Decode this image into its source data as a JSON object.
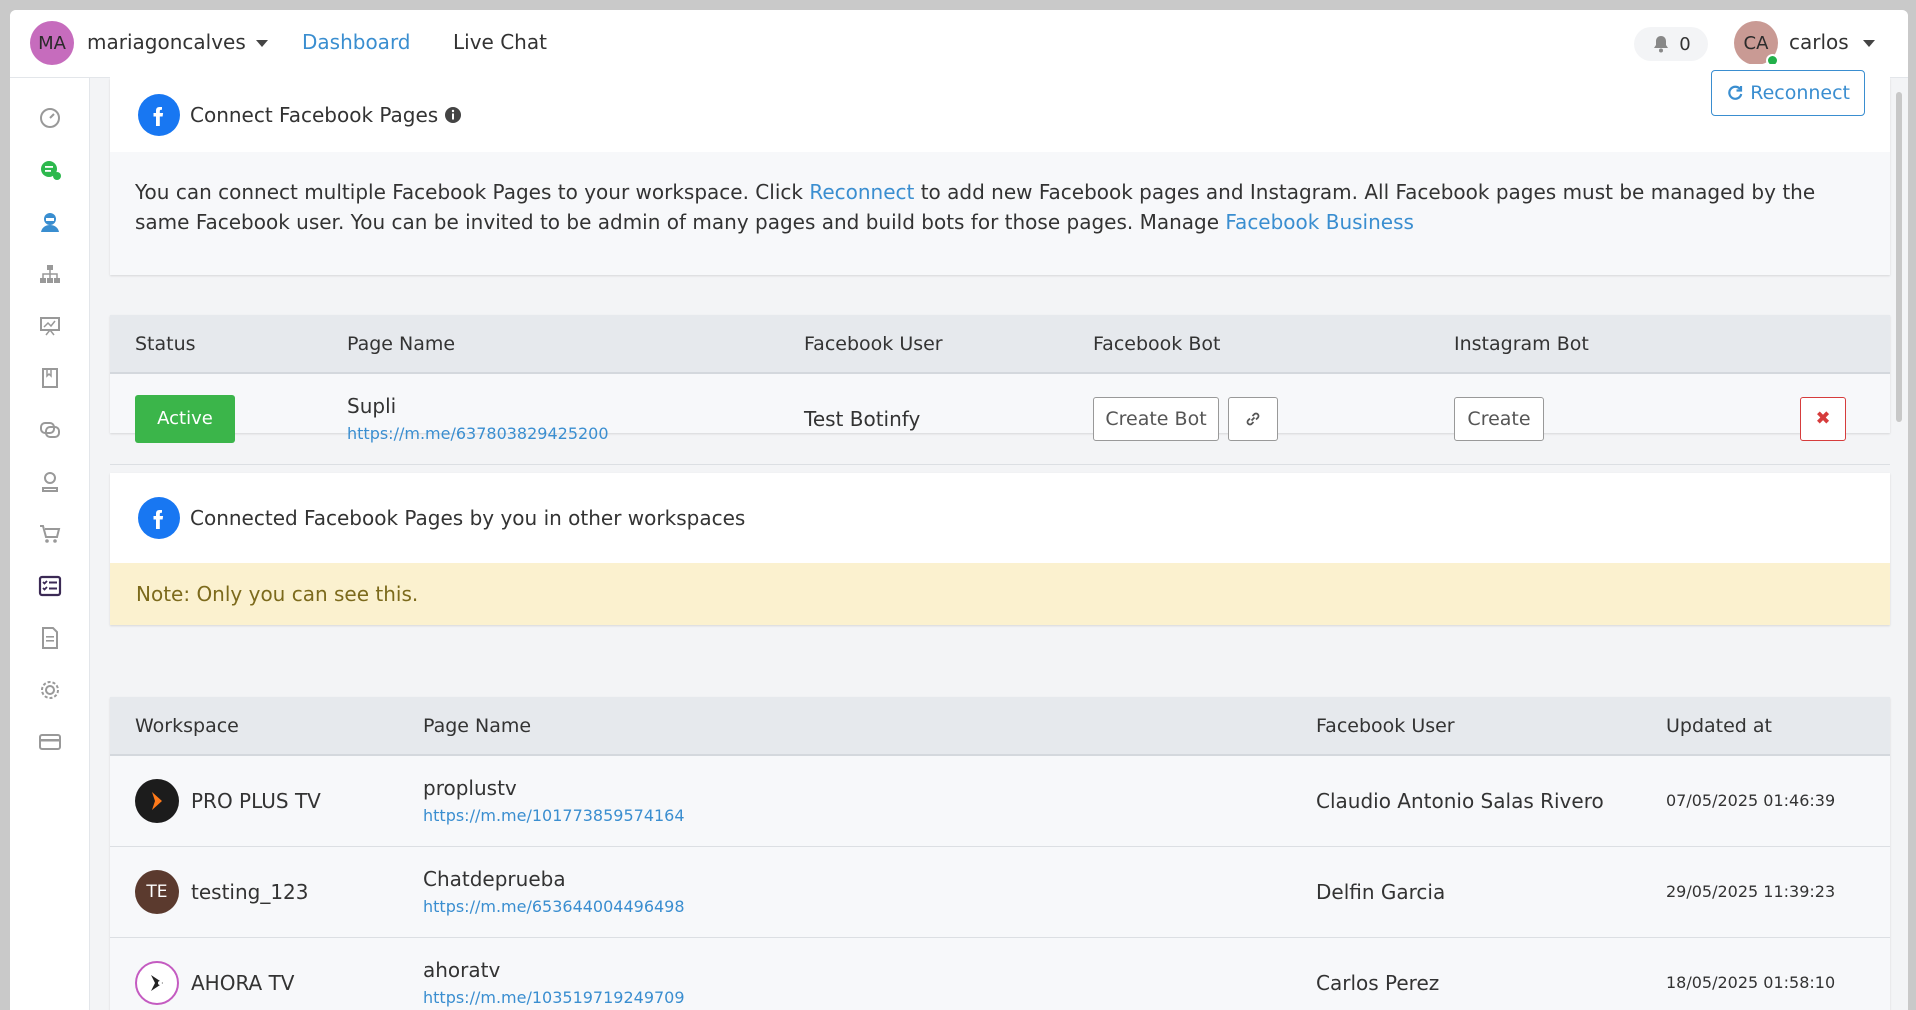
{
  "topbar": {
    "workspace_initials": "MA",
    "workspace_name": "mariagoncalves",
    "nav_dashboard": "Dashboard",
    "nav_livechat": "Live Chat",
    "notification_count": "0",
    "user_initials": "CA",
    "user_name": "carlos"
  },
  "sidebar": {
    "icons": [
      "dashboard-icon",
      "chat-icon",
      "support-agent-icon",
      "flow-icon",
      "presentation-icon",
      "book-icon",
      "messages-icon",
      "user-icon",
      "cart-icon",
      "checklist-icon",
      "document-icon",
      "settings-icon",
      "billing-icon"
    ]
  },
  "connect_card": {
    "title": "Connect Facebook Pages",
    "reconnect_button": "Reconnect",
    "desc_part1": "You can connect multiple Facebook Pages to your workspace. Click ",
    "desc_link1": "Reconnect",
    "desc_part2": " to add new Facebook pages and Instagram. All Facebook pages must be managed by the same Facebook user. You can be invited to be admin of many pages and build bots for those pages. Manage ",
    "desc_link2": "Facebook Business"
  },
  "pages_table": {
    "headers": [
      "Status",
      "Page Name",
      "Facebook User",
      "Facebook Bot",
      "Instagram Bot"
    ],
    "row": {
      "status": "Active",
      "page_name": "Supli",
      "page_link": "https://m.me/637803829425200",
      "facebook_user": "Test Botinfy",
      "create_bot": "Create Bot",
      "instagram_create": "Create"
    }
  },
  "other_card": {
    "title": "Connected Facebook Pages by you in other workspaces",
    "note": "Note: Only you can see this."
  },
  "other_table": {
    "headers": [
      "Workspace",
      "Page Name",
      "Facebook User",
      "Updated at"
    ],
    "rows": [
      {
        "workspace": "PRO PLUS TV",
        "initials": "",
        "page_name": "proplustv",
        "page_link": "https://m.me/101773859574164",
        "facebook_user": "Claudio Antonio Salas Rivero",
        "updated": "07/05/2025 01:46:39"
      },
      {
        "workspace": "testing_123",
        "initials": "TE",
        "page_name": "Chatdeprueba",
        "page_link": "https://m.me/653644004496498",
        "facebook_user": "Delfin Garcia",
        "updated": "29/05/2025 11:39:23"
      },
      {
        "workspace": "AHORA TV",
        "initials": "",
        "page_name": "ahoratv",
        "page_link": "https://m.me/103519719249709",
        "facebook_user": "Carlos Perez",
        "updated": "18/05/2025 01:58:10"
      }
    ]
  },
  "colors": {
    "accent": "#3a8ed0",
    "active": "#3bb54a",
    "danger": "#d63c3c",
    "facebook": "#1877f2",
    "note_bg": "#fbf1cf"
  }
}
